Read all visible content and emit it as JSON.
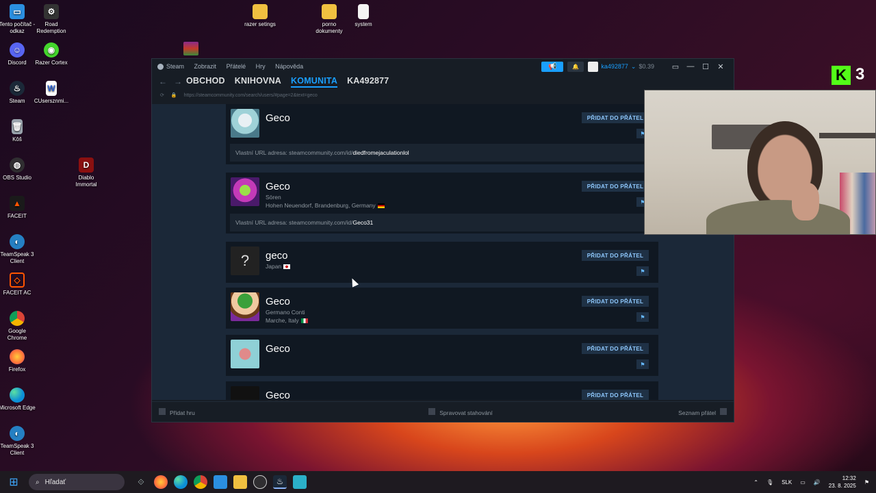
{
  "desktop": {
    "icons": [
      {
        "label": "Tento počítač - odkaz",
        "color": "#2b8fe0"
      },
      {
        "label": "Road Redemption",
        "color": "#333333"
      },
      {
        "label": "razer setings",
        "color": "#f0c040"
      },
      {
        "label": "porno dokumenty",
        "color": "#f0c040"
      },
      {
        "label": "system",
        "color": "#f4f4f4"
      },
      {
        "label": "Discord",
        "color": "#5865f2"
      },
      {
        "label": "Razer Cortex",
        "color": "#44d62c"
      },
      {
        "label": "Steam",
        "color": "#1b2838"
      },
      {
        "label": "CUsersznmi...",
        "color": "#ffffff"
      },
      {
        "label": "Kôš",
        "color": "#9aa4ad"
      },
      {
        "label": "OBS Studio",
        "color": "#302e31"
      },
      {
        "label": "Diablo Immortal",
        "color": "#8a1010"
      },
      {
        "label": "FACEIT",
        "color": "#ff5500"
      },
      {
        "label": "TeamSpeak 3 Client",
        "color": "#2580c3"
      },
      {
        "label": "FACEIT AC",
        "color": "#ff5500"
      },
      {
        "label": "Google Chrome",
        "color": "#db4437"
      },
      {
        "label": "Firefox",
        "color": "#ff7139"
      },
      {
        "label": "Microsoft Edge",
        "color": "#0c8fd6"
      },
      {
        "label": "TeamSpeak 3 Client",
        "color": "#2580c3"
      }
    ]
  },
  "steam": {
    "titlebar": {
      "menu": [
        "Steam",
        "Zobrazit",
        "Přátelé",
        "Hry",
        "Nápověda"
      ],
      "account": "ka492877",
      "balance": "$0.39"
    },
    "nav": {
      "tabs": [
        "OBCHOD",
        "KNIHOVNA",
        "KOMUNITA",
        "KA492877"
      ],
      "active": "KOMUNITA"
    },
    "url": "https://steamcommunity.com/search/users/#page=2&text=geco",
    "add_friend_label": "PŘIDAT DO PŘÁTEL",
    "results": [
      {
        "name": "Geco",
        "lines": [],
        "url_prefix": "Vlastní URL adresa: steamcommunity.com/id/",
        "url_id": "diedfromejaculationlol",
        "avatar_color": "#9fd2d8"
      },
      {
        "name": "Geco",
        "lines": [
          "Sören",
          "Hohen Neuendorf, Brandenburg, Germany"
        ],
        "url_prefix": "Vlastní URL adresa: steamcommunity.com/id/",
        "url_id": "Geco31",
        "avatar_color": "#6a2a8a"
      },
      {
        "name": "geco",
        "lines": [
          "Japan"
        ],
        "avatar_color": "#222222",
        "avatar_text": "?"
      },
      {
        "name": "Geco",
        "lines": [
          "Germano Conti",
          "Marche, Italy"
        ],
        "avatar_color": "#3aa03a"
      },
      {
        "name": "Geco",
        "lines": [],
        "avatar_color": "#8fd0d6"
      },
      {
        "name": "Geco",
        "lines": [],
        "avatar_color": "#111111"
      }
    ],
    "bottom": {
      "add_game": "Přidat hru",
      "downloads": "Spravovat stahování",
      "friends": "Seznam přátel"
    }
  },
  "stream_overlay": {
    "kick_badge": "K",
    "count": "3"
  },
  "taskbar": {
    "search_placeholder": "Hľadať",
    "language": "SLK",
    "time": "12:32",
    "date": "23. 8. 2025"
  }
}
